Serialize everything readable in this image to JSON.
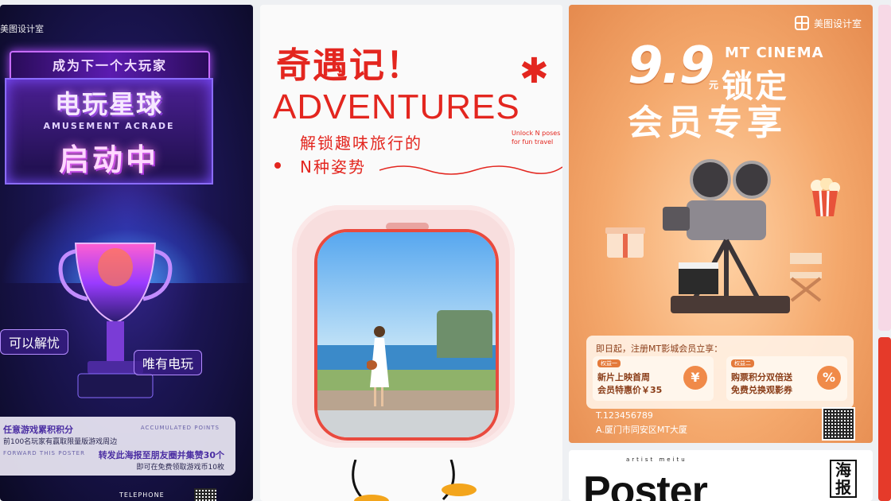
{
  "game_poster": {
    "brand": "美图设计室",
    "ribbon": "成为下一个大玩家",
    "title_line1": "电玩星球",
    "title_en": "AMUSEMENT ACRADE",
    "title_line2": "启动中",
    "tag_left": "可以解忧",
    "tag_right": "唯有电玩",
    "info_row1": "任意游戏累积积分",
    "info_row1_en": "ACCUMULATED POINTS",
    "info_row2": "前100名玩家有赢取限量版游戏周边",
    "info_row3_en": "FORWARD THIS POSTER",
    "info_row3": "转发此海报至朋友圈并集赞30个",
    "info_row4": "即可在免费领取游戏币10枚",
    "telephone": "TELEPHONE"
  },
  "travel_poster": {
    "title_cn": "奇遇记！",
    "star": "✱",
    "title_en": "ADVENTURES",
    "sub_line1": "解锁趣味旅行的",
    "sub_line2": "N种姿势",
    "small_en": "Unlock N poses for fun travel"
  },
  "cinema_poster": {
    "logo_text": "美图设计室",
    "price": "9.9",
    "price_unit": "元",
    "brand_en": "MT CINEMA",
    "headline1": "锁定",
    "headline2": "会员专享",
    "info_header": "即日起，注册MT影城会员立享：",
    "benefit1_badge": "权益一",
    "benefit1_line1": "新片上映首周",
    "benefit1_line2": "会员特惠价￥35",
    "benefit1_icon": "¥",
    "benefit2_badge": "权益二",
    "benefit2_line1": "购票积分双倍送",
    "benefit2_line2": "免费兑换观影券",
    "benefit2_icon": "%",
    "phone": "T.123456789",
    "address": "A.厦门市同安区MT大厦"
  },
  "poster_card": {
    "artist": "artist meitu",
    "big_word": "Poster",
    "side_text": "海报"
  },
  "colors": {
    "travel_red": "#e3261f",
    "game_purple": "#5b1bb0",
    "cinema_orange": "#f4a86c"
  }
}
